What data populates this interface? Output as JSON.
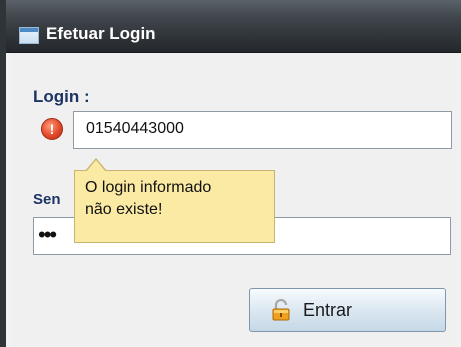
{
  "window": {
    "title": "Efetuar Login"
  },
  "form": {
    "login_label": "Login :",
    "login_value": "01540443000",
    "senha_label": "Sen",
    "senha_masked": "•••"
  },
  "tooltip": {
    "line1": "O login informado",
    "line2": "não existe!"
  },
  "button": {
    "label": "Entrar",
    "icon": "lock-icon"
  },
  "icons": {
    "error": "error-icon",
    "window": "window-icon"
  },
  "colors": {
    "label_color": "#1f3466",
    "tooltip_bg": "#fbeaa4",
    "error_red": "#e24a2a"
  }
}
